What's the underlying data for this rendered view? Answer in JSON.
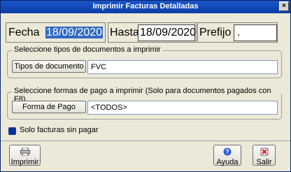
{
  "window": {
    "title": "Imprimir Facturas Detalladas"
  },
  "dates": {
    "fecha_label": "Fecha",
    "fecha_value": "18/09/2020",
    "hasta_label": "Hasta",
    "hasta_value": "18/09/2020",
    "prefijo_label": "Prefijo",
    "prefijo_value": "."
  },
  "doc_types": {
    "group_title": "Seleccione tipos de documentos a imprimir",
    "button_label": "Tipos de documento",
    "value": "FVC"
  },
  "payment": {
    "group_title": "Seleccione formas de pago a imprimir (Solo para documentos pagados con F8)",
    "button_label": "Forma de Pago",
    "value": "<TODOS>"
  },
  "options": {
    "unpaid_only_label": "Solo facturas sin pagar",
    "unpaid_only_checked": true
  },
  "footer": {
    "print_label": "Imprimir",
    "help_label": "Ayuda",
    "exit_label": "Salir"
  },
  "icons": {
    "close": "close-icon",
    "print": "printer-icon",
    "help": "help-icon",
    "exit": "exit-icon"
  }
}
